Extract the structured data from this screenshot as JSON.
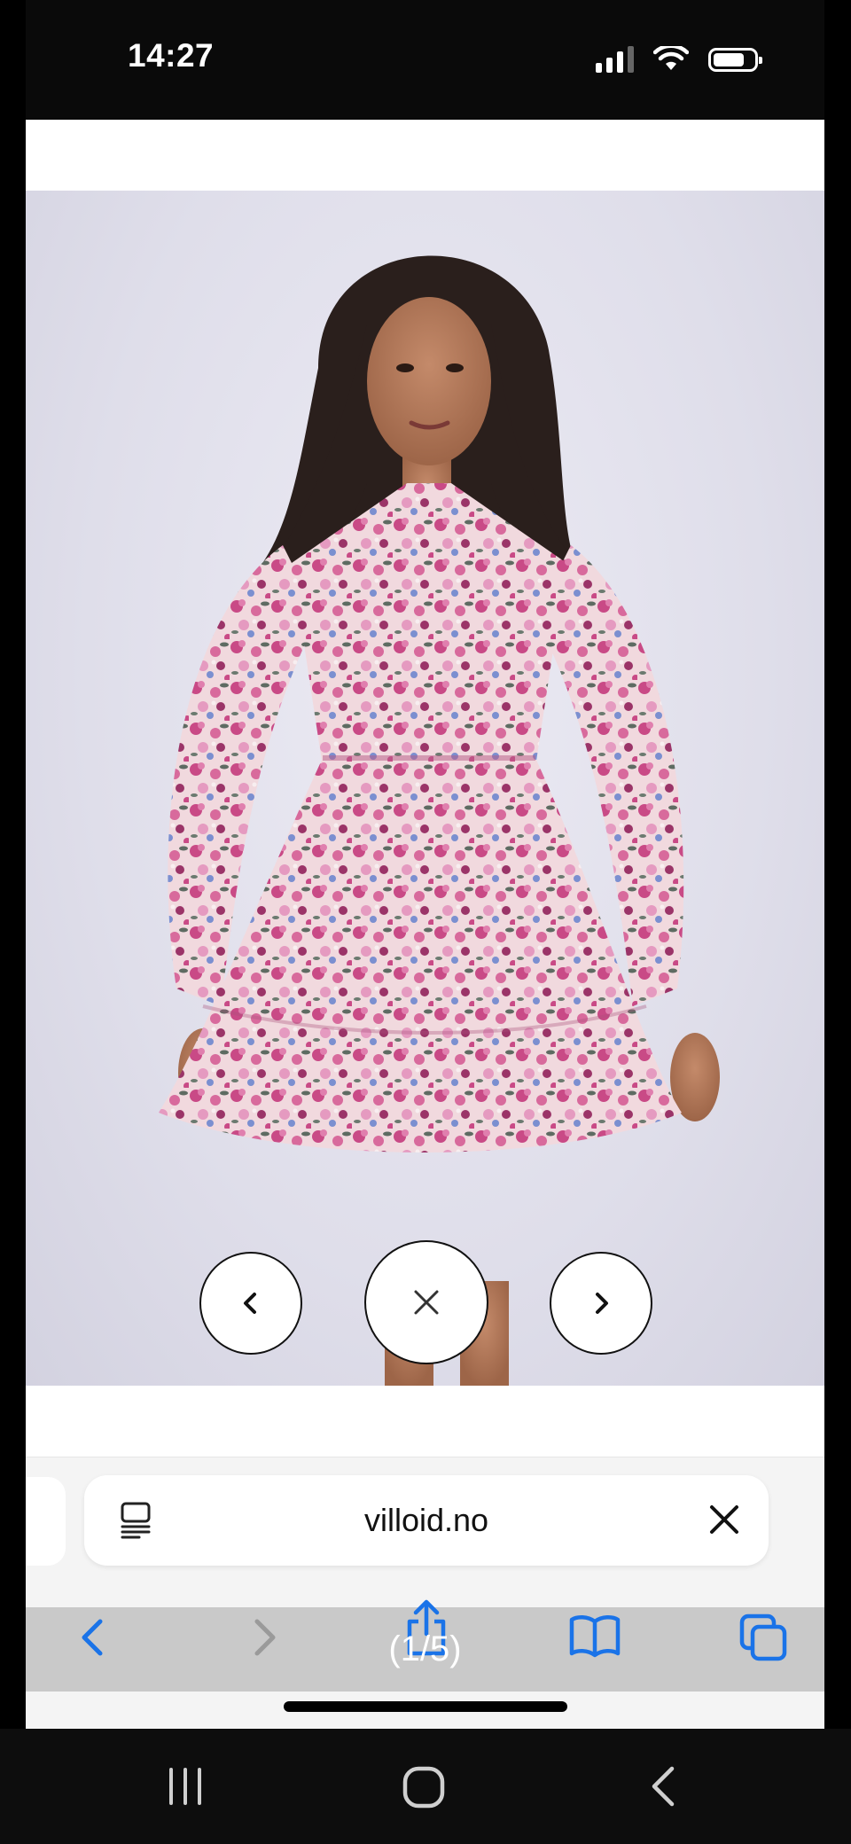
{
  "status_bar": {
    "time": "14:27",
    "signal_icon": "cellular-signal-icon",
    "wifi_icon": "wifi-icon",
    "battery_icon": "battery-icon",
    "battery_level": 0.75
  },
  "gallery": {
    "image_description_icon": "product-photo",
    "prev_icon": "chevron-left-icon",
    "close_icon": "close-icon",
    "next_icon": "chevron-right-icon",
    "counter": "(1/5)"
  },
  "browser": {
    "url": "villoid.no",
    "reader_icon": "reader-mode-icon",
    "clear_icon": "close-icon",
    "toolbar": {
      "back_icon": "chevron-left-icon",
      "forward_icon": "chevron-right-icon",
      "share_icon": "share-icon",
      "bookmarks_icon": "book-icon",
      "tabs_icon": "tabs-icon"
    },
    "accent_color": "#1a73e8"
  },
  "android_nav": {
    "recents_icon": "recents-icon",
    "home_icon": "home-icon",
    "back_icon": "back-icon"
  }
}
